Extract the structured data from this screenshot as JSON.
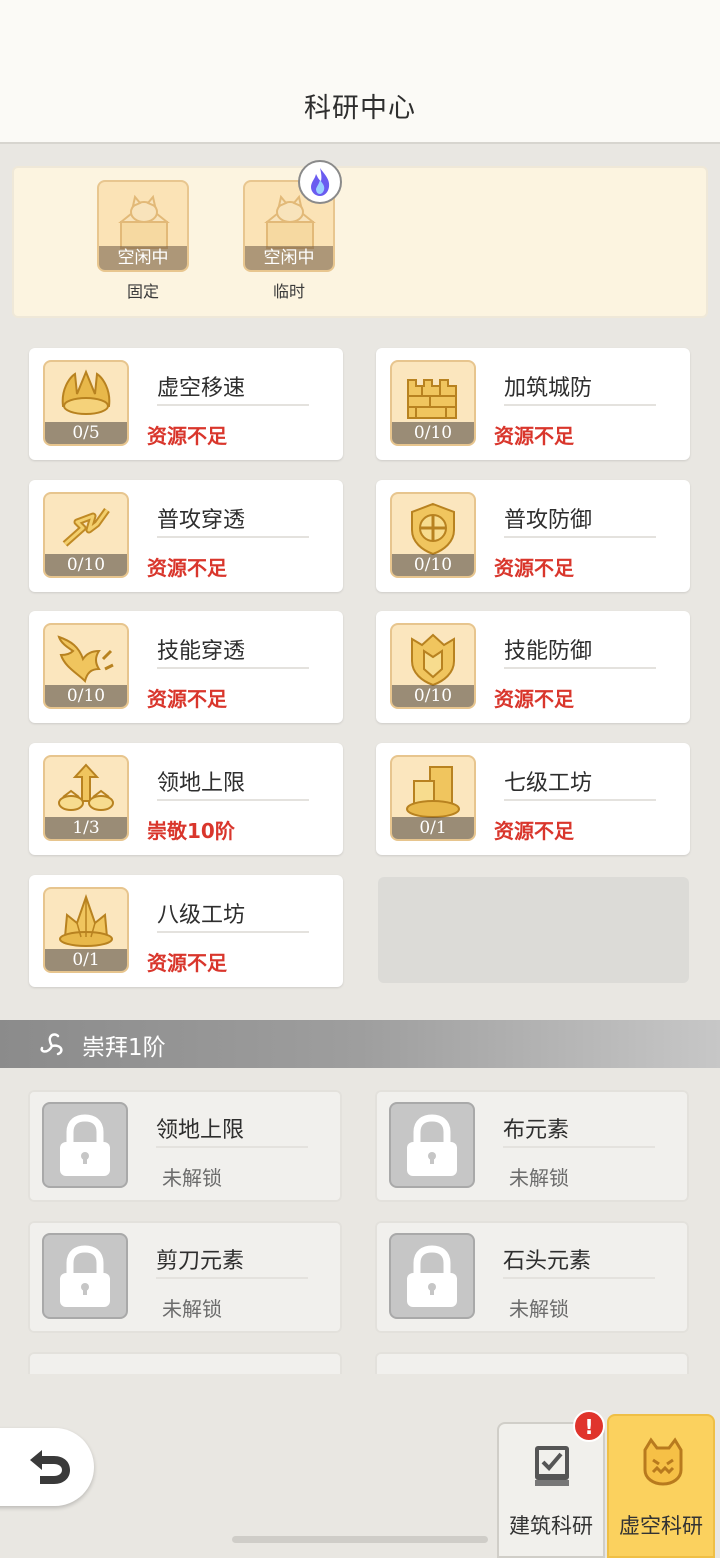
{
  "header": {
    "title": "科研中心"
  },
  "workers": [
    {
      "state": "空闲中",
      "type": "固定"
    },
    {
      "state": "空闲中",
      "type": "临时"
    }
  ],
  "research": [
    {
      "name": "虚空移速",
      "progress": "0/5",
      "status": "资源不足",
      "icon": "claw-crown-icon"
    },
    {
      "name": "加筑城防",
      "progress": "0/10",
      "status": "资源不足",
      "icon": "wall-icon"
    },
    {
      "name": "普攻穿透",
      "progress": "0/10",
      "status": "资源不足",
      "icon": "broken-arrow-icon"
    },
    {
      "name": "普攻防御",
      "progress": "0/10",
      "status": "资源不足",
      "icon": "cross-shield-icon"
    },
    {
      "name": "技能穿透",
      "progress": "0/10",
      "status": "资源不足",
      "icon": "flame-wing-icon"
    },
    {
      "name": "技能防御",
      "progress": "0/10",
      "status": "资源不足",
      "icon": "crest-shield-icon"
    },
    {
      "name": "领地上限",
      "progress": "1/3",
      "status": "崇敬10阶",
      "icon": "territory-arrow-icon"
    },
    {
      "name": "七级工坊",
      "progress": "0/1",
      "status": "资源不足",
      "icon": "workshop-blocks-icon"
    },
    {
      "name": "八级工坊",
      "progress": "0/1",
      "status": "资源不足",
      "icon": "crystal-icon"
    }
  ],
  "section": {
    "title": "崇拜1阶"
  },
  "locked": [
    {
      "name": "领地上限",
      "status": "未解锁"
    },
    {
      "name": "布元素",
      "status": "未解锁"
    },
    {
      "name": "剪刀元素",
      "status": "未解锁"
    },
    {
      "name": "石头元素",
      "status": "未解锁"
    }
  ],
  "tabs": {
    "build": "建筑科研",
    "void": "虚空科研",
    "alert": "!"
  },
  "colors": {
    "accent": "#fbd15e",
    "warning": "#d9362c",
    "locked": "#6c6c6c"
  }
}
